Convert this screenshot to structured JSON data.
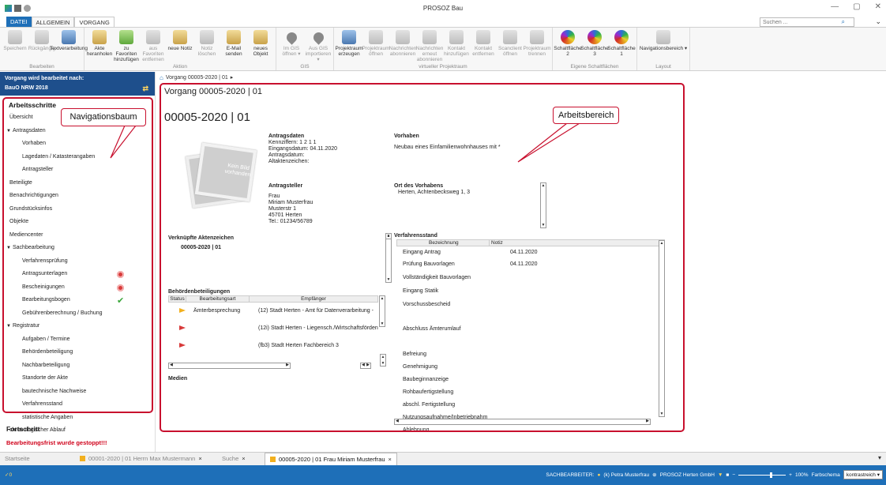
{
  "window": {
    "title": "PROSOZ Bau",
    "minimize": "—",
    "maximize": "▢",
    "close": "✕"
  },
  "ribbon_tabs": [
    "DATEI",
    "ALLGEMEIN",
    "VORGANG"
  ],
  "search": {
    "placeholder": "Suchen ..."
  },
  "ribbon": {
    "groups": [
      {
        "label": "Bearbeiten",
        "buttons": [
          {
            "label": "Speichern",
            "icon": "save-icon",
            "disabled": true
          },
          {
            "label": "Rückgängig",
            "icon": "undo-icon",
            "disabled": true
          },
          {
            "label": "Textverarbeitung",
            "icon": "word-processing-icon",
            "disabled": false
          }
        ]
      },
      {
        "label": "Aktion",
        "buttons": [
          {
            "label": "Akte heranholen",
            "icon": "fetch-file-icon",
            "disabled": false
          },
          {
            "label": "zu Favoriten hinzufügen",
            "icon": "add-favorite-icon",
            "disabled": false
          },
          {
            "label": "aus Favoriten entfernen",
            "icon": "remove-favorite-icon",
            "disabled": true
          },
          {
            "label": "neue Notiz",
            "icon": "new-note-icon",
            "disabled": false
          },
          {
            "label": "Notiz löschen",
            "icon": "delete-note-icon",
            "disabled": true
          },
          {
            "label": "E-Mail senden",
            "icon": "email-icon",
            "disabled": false
          },
          {
            "label": "neues Objekt",
            "icon": "new-object-icon",
            "disabled": false
          }
        ]
      },
      {
        "label": "GIS",
        "buttons": [
          {
            "label": "Im GIS öffnen ▾",
            "icon": "gis-open-icon",
            "disabled": true
          },
          {
            "label": "Aus GIS importieren ▾",
            "icon": "gis-import-icon",
            "disabled": true
          }
        ]
      },
      {
        "label": "virtueller Projektraum",
        "buttons": [
          {
            "label": "Projektraum erzeugen",
            "icon": "project-room-create-icon",
            "disabled": false
          },
          {
            "label": "Projektraum öffnen",
            "icon": "project-room-open-icon",
            "disabled": true
          },
          {
            "label": "Nachrichten abonnieren",
            "icon": "subscribe-icon",
            "disabled": true
          },
          {
            "label": "Nachrichten erneut abonnieren",
            "icon": "resubscribe-icon",
            "disabled": true
          },
          {
            "label": "Kontakt hinzufügen",
            "icon": "add-contact-icon",
            "disabled": true
          },
          {
            "label": "Kontakt entfernen",
            "icon": "remove-contact-icon",
            "disabled": true
          },
          {
            "label": "Scanclient öffnen",
            "icon": "scanner-icon",
            "disabled": true
          },
          {
            "label": "Projektraum trennen",
            "icon": "disconnect-icon",
            "disabled": true
          }
        ]
      },
      {
        "label": "Eigene Schaltflächen",
        "buttons": [
          {
            "label": "Schaltfläche 2",
            "icon": "custom-button-icon",
            "disabled": false
          },
          {
            "label": "Schaltfläche 3",
            "icon": "custom-button-icon",
            "disabled": false
          },
          {
            "label": "Schaltfläche 1",
            "icon": "custom-button-icon",
            "disabled": false
          }
        ]
      },
      {
        "label": "Layout",
        "buttons": [
          {
            "label": "Navigationsbereich ▾",
            "icon": "layout-icon",
            "disabled": false
          }
        ]
      }
    ]
  },
  "breadcrumb": {
    "text": "Vorgang 00005-2020 | 01",
    "sep": "▸"
  },
  "left": {
    "bearbeitet_label": "Vorgang wird bearbeitet nach:",
    "bearbeitet_value": "BauO NRW 2018",
    "nav_header": "Arbeitsschritte",
    "callout": "Navigationsbaum",
    "items": [
      {
        "label": "Übersicht",
        "level": 0,
        "status": ""
      },
      {
        "label": "Antragsdaten",
        "level": -1,
        "status": ""
      },
      {
        "label": "Vorhaben",
        "level": 1,
        "status": ""
      },
      {
        "label": "Lagedaten / Katasterangaben",
        "level": 1,
        "status": ""
      },
      {
        "label": "Antragsteller",
        "level": 1,
        "status": ""
      },
      {
        "label": "Beteiligte",
        "level": 0,
        "status": ""
      },
      {
        "label": "Benachrichtigungen",
        "level": 0,
        "status": ""
      },
      {
        "label": "Grundstücksinfos",
        "level": 0,
        "status": ""
      },
      {
        "label": "Objekte",
        "level": 0,
        "status": ""
      },
      {
        "label": "Mediencenter",
        "level": 0,
        "status": ""
      },
      {
        "label": "Sachbearbeitung",
        "level": -1,
        "status": ""
      },
      {
        "label": "Verfahrensprüfung",
        "level": 1,
        "status": ""
      },
      {
        "label": "Antragsunterlagen",
        "level": 1,
        "status": "error"
      },
      {
        "label": "Bescheinigungen",
        "level": 1,
        "status": "error"
      },
      {
        "label": "Bearbeitungsbogen",
        "level": 1,
        "status": "ok"
      },
      {
        "label": "Gebührenberechnung / Buchung",
        "level": 1,
        "status": ""
      },
      {
        "label": "Registratur",
        "level": -1,
        "status": ""
      },
      {
        "label": "Aufgaben / Termine",
        "level": 1,
        "status": ""
      },
      {
        "label": "Behördenbeteiligung",
        "level": 1,
        "status": ""
      },
      {
        "label": "Nachbarbeteiligung",
        "level": 1,
        "status": ""
      },
      {
        "label": "Standorte der Akte",
        "level": 1,
        "status": ""
      },
      {
        "label": "bautechnische Nachweise",
        "level": 1,
        "status": ""
      },
      {
        "label": "Verfahrensstand",
        "level": 1,
        "status": ""
      },
      {
        "label": "statistische Angaben",
        "level": 1,
        "status": ""
      },
      {
        "label": "chronologischer Ablauf",
        "level": 0,
        "status": ""
      }
    ],
    "fortschritt_header": "Fortschritt",
    "fortschritt_message": "Bearbeitungsfrist wurde gestoppt!!!"
  },
  "work": {
    "callout": "Arbeitsbereich",
    "title": "Vorgang 00005-2020 | 01",
    "big_title": "00005-2020 | 01",
    "photo_text": "Kein Bild vorhanden",
    "antragsdaten": {
      "title": "Antragsdaten",
      "lines": [
        "Kennziffern: 1 2 1 1",
        "Eingangsdatum: 04.11.2020",
        "Antragsdatum:",
        "Altaktenzeichen:"
      ]
    },
    "vorhaben": {
      "title": "Vorhaben",
      "text": "Neubau eines Einfamilienwohnhauses mit *"
    },
    "antragsteller": {
      "title": "Antragsteller",
      "lines": [
        "Frau",
        "Miriam Musterfrau",
        "Musterstr 1",
        "45701 Herten",
        "Tel.: 01234/56789"
      ]
    },
    "ort": {
      "title": "Ort des Vorhabens",
      "text": "Herten, Achtenbecksweg 1, 3"
    },
    "aktenzeichen": {
      "title": "Verknüpfte Aktenzeichen",
      "value": "00005-2020 | 01"
    },
    "beteiligungen": {
      "title": "Behördenbeteiligungen",
      "columns": [
        "Status",
        "Bearbeitungsart",
        "Empfänger"
      ],
      "rows": [
        {
          "status": "yellow",
          "art": "Ämterbesprechung",
          "empf": "(12) Stadt Herten  - Amt für Datenverarbeitung -"
        },
        {
          "status": "red",
          "art": "",
          "empf": "(12i) Stadt Herten  - Liegensch./Wirtschaftsförden"
        },
        {
          "status": "red",
          "art": "",
          "empf": "(fb3) Stadt Herten  Fachbereich 3"
        }
      ]
    },
    "medien": {
      "title": "Medien"
    },
    "verfahrensstand": {
      "title": "Verfahrensstand",
      "columns": [
        "Bezeichnung",
        "Notiz"
      ],
      "rows": [
        {
          "label": "Eingang Antrag",
          "date": "04.11.2020"
        },
        {
          "label": "Prüfung Bauvorlagen",
          "date": "04.11.2020"
        },
        {
          "label": "Vollständigkeit Bauvorlagen",
          "date": ""
        },
        {
          "label": "Eingang Statik",
          "date": ""
        },
        {
          "label": "Vorschussbescheid",
          "date": ""
        },
        {
          "label": "Abschluss Ämterumlauf",
          "date": ""
        },
        {
          "label": "Befreiung",
          "date": ""
        },
        {
          "label": "Genehmigung",
          "date": ""
        },
        {
          "label": "Baubeginnanzeige",
          "date": ""
        },
        {
          "label": "Rohbaufertigstellung",
          "date": ""
        },
        {
          "label": "abschl. Fertigstellung",
          "date": ""
        },
        {
          "label": "Nutzungsaufnahme/Inbetriebnahm",
          "date": ""
        },
        {
          "label": "Ablehnung",
          "date": ""
        }
      ]
    }
  },
  "bottom_tabs": [
    {
      "label": "Startseite",
      "active": false,
      "closable": false
    },
    {
      "label": "00001-2020 | 01 Herrn Max Mustermann",
      "active": false,
      "closable": true
    },
    {
      "label": "Suche",
      "active": false,
      "closable": true
    },
    {
      "label": "00005-2020 | 01 Frau Miriam Musterfrau",
      "active": true,
      "closable": true
    }
  ],
  "status": {
    "left": "✓0",
    "sachbearbeiter": "SACHBEARBEITER:",
    "user": "(k) Petra Musterfrau",
    "org": "PROSOZ Herten GmbH",
    "zoom": "100%",
    "farbschema_label": "Farbschema",
    "farbschema_value": "kontrastreich",
    "zoom_minus": "−",
    "zoom_plus": "+"
  },
  "colors": {
    "accent": "#1e6fb8",
    "callout_border": "#c8102e",
    "nav_header_bg": "#1e4f8c",
    "warning": "#d0021b"
  }
}
